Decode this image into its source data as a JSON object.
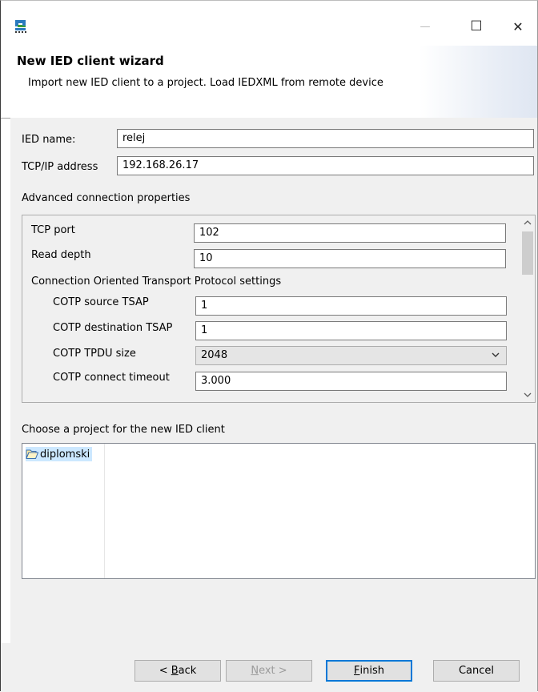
{
  "window": {
    "controls": {
      "minimize": "—",
      "maximize": "☐",
      "close": "✕"
    }
  },
  "banner": {
    "title": "New IED client wizard",
    "subtitle": "Import new IED client to a project. Load IEDXML from remote device"
  },
  "form": {
    "ied_name_label": "IED name:",
    "ied_name_value": "relej",
    "tcp_ip_label": "TCP/IP address",
    "tcp_ip_value": "192.168.26.17",
    "advanced_label": "Advanced connection properties"
  },
  "advanced": {
    "tcp_port_label": "TCP port",
    "tcp_port_value": "102",
    "read_depth_label": "Read depth",
    "read_depth_value": "10",
    "cotp_group_label": "Connection Oriented Transport Protocol settings",
    "cotp_source_label": "COTP source TSAP",
    "cotp_source_value": "1",
    "cotp_dest_label": "COTP destination TSAP",
    "cotp_dest_value": "1",
    "cotp_tpdu_label": "COTP TPDU size",
    "cotp_tpdu_value": "2048",
    "cotp_timeout_label": "COTP connect timeout",
    "cotp_timeout_value": "3.000"
  },
  "project": {
    "label": "Choose a project for the new IED client",
    "items": [
      {
        "name": "diplomski",
        "icon": "folder-open-icon",
        "selected": true
      }
    ]
  },
  "buttons": {
    "back": {
      "mnemonic": "B",
      "rest": "ack",
      "prefix": "< "
    },
    "next": {
      "mnemonic": "N",
      "rest": "ext >"
    },
    "finish": {
      "mnemonic": "F",
      "rest": "inish"
    },
    "cancel": "Cancel"
  },
  "colors": {
    "selection": "#cce8ff",
    "default_button_border": "#0078d7",
    "dialog_background": "#f0f0f0"
  }
}
